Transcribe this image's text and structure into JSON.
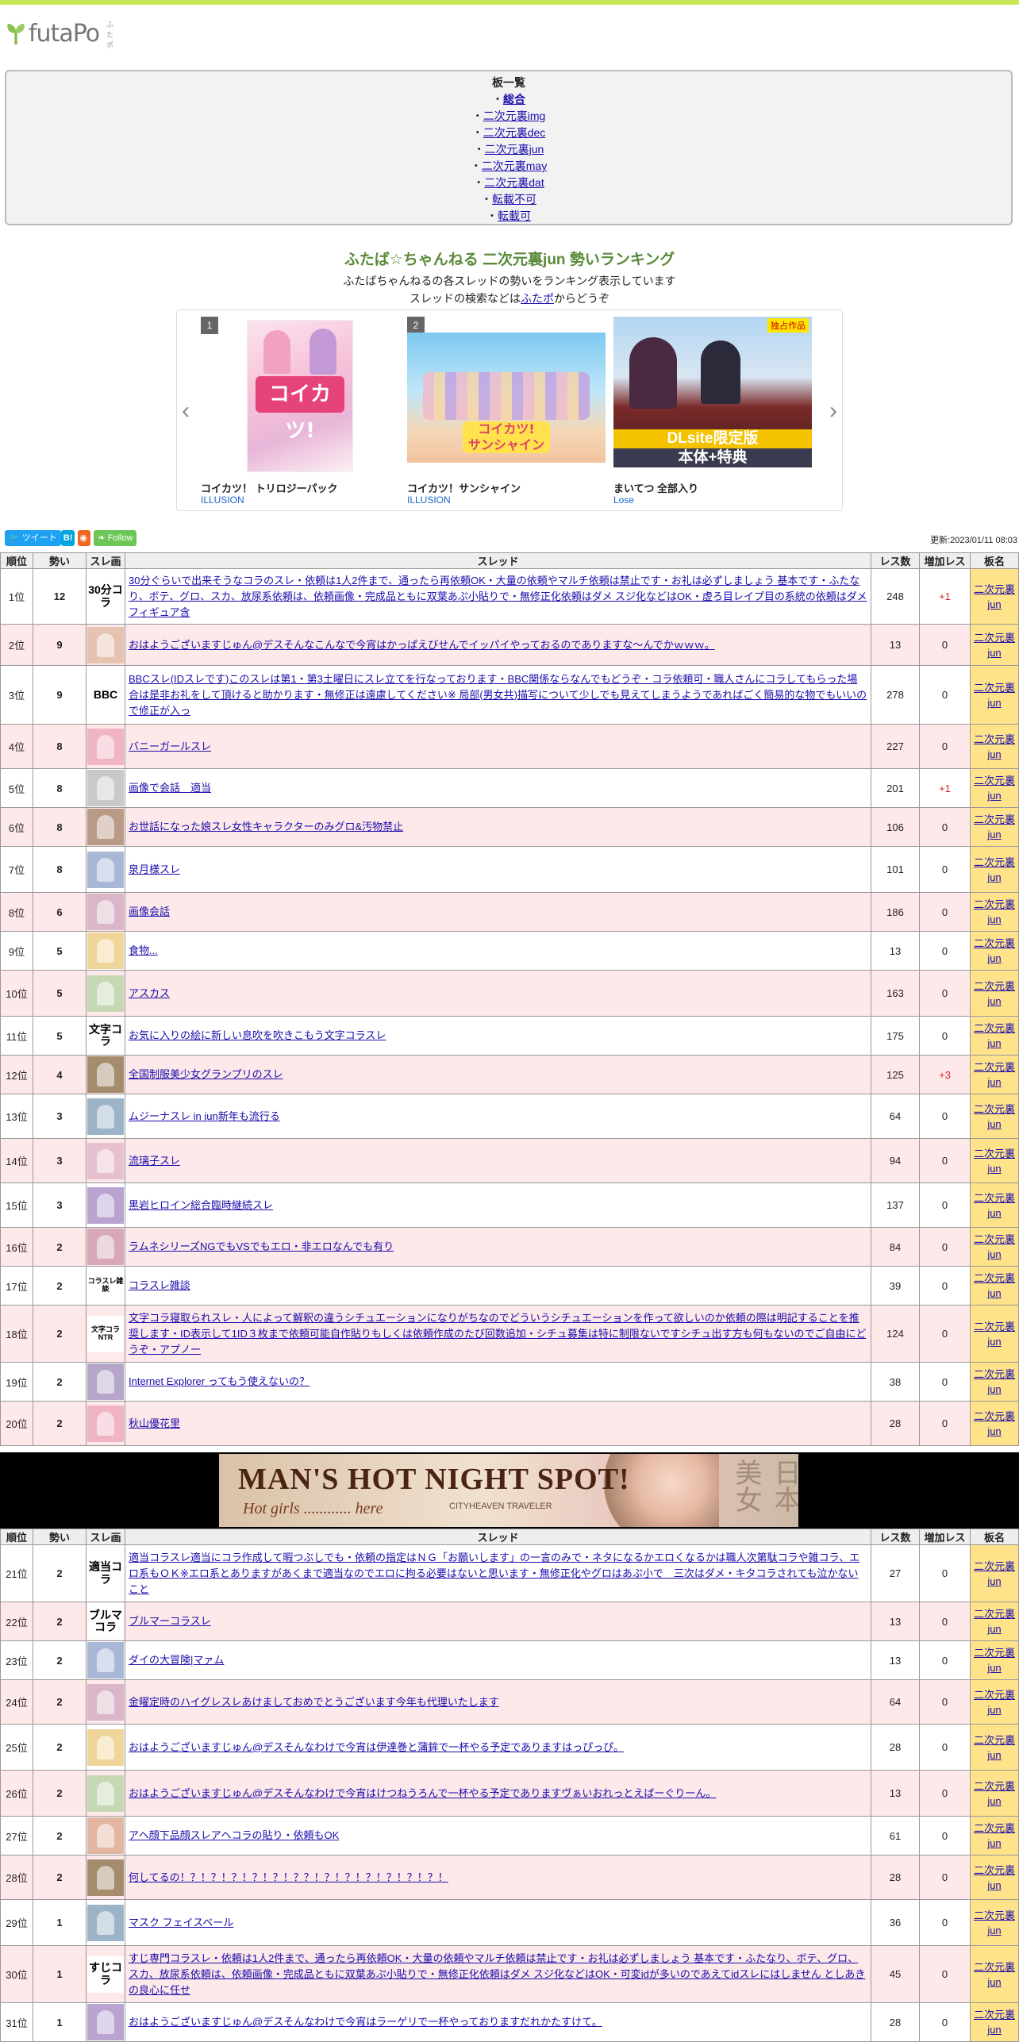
{
  "site": {
    "logo_text": "futaPo",
    "logo_sub": "ふたポ"
  },
  "board_list": {
    "title": "板一覧",
    "items": [
      "総合",
      "二次元裏img",
      "二次元裏dec",
      "二次元裏jun",
      "二次元裏may",
      "二次元裏dat",
      "転載不可",
      "転載可"
    ]
  },
  "ranking": {
    "title": "ふたば☆ちゃんねる 二次元裏jun 勢いランキング",
    "desc1": "ふたばちゃんねるの各スレッドの勢いをランキング表示しています",
    "desc2_pre": "スレッドの検索などは",
    "desc2_link": "ふたポ",
    "desc2_post": "からどうぞ"
  },
  "carousel": [
    {
      "num": "1",
      "name": "コイカツ！ トリロジーパック",
      "maker": "ILLUSION",
      "badge": ""
    },
    {
      "num": "2",
      "name": "コイカツ！サンシャイン",
      "maker": "ILLUSION",
      "badge": ""
    },
    {
      "num": "3",
      "name": "まいてつ 全部入り",
      "maker": "Lose",
      "badge": "独占作品",
      "img_text1": "DLsite限定版",
      "img_text2": "本体+特典"
    }
  ],
  "share": {
    "tweet": "ツイート",
    "hatena": "B!",
    "follow": "Follow"
  },
  "updated": "更新:2023/01/11 08:03",
  "table_headers": [
    "順位",
    "勢い",
    "スレ画",
    "スレッド",
    "レス数",
    "増加レス",
    "板名"
  ],
  "board_name": "二次元裏jun",
  "banner": {
    "headline": "MAN'S HOT NIGHT SPOT!",
    "sub": "Hot girls ............ here",
    "city": "CITYHEAVEN TRAVELER",
    "jp": "日本美女"
  },
  "rows": [
    {
      "rank": "1位",
      "ikioi": "12",
      "thumb": "30分コラ",
      "title": "30分ぐらいで出来そうなコラのスレ・依頼は1人2件まで、通ったら再依頼OK・大量の依頼やマルチ依頼は禁止です・お礼は必ずしましょう 基本です・ふたなり、ボテ、グロ、スカ、放尿系依頼は、依頼画像・完成品ともに双葉あぷ小貼りで・無修正化依頼はダメ スジ化などはOK・虚ろ目レイプ目の系統の依頼はダメ フィギュア含",
      "res": "248",
      "inc": "+1"
    },
    {
      "rank": "2位",
      "ikioi": "9",
      "thumb": "",
      "title": "おはようございますじゅん@デスそんなこんなで今宵はかっぱえびせんでイッパイやっておるのでありますな～んでかｗｗｗ。",
      "res": "13",
      "inc": "0"
    },
    {
      "rank": "3位",
      "ikioi": "9",
      "thumb": "BBC",
      "title": "BBCスレ(IDスレです)このスレは第1・第3土曜日にスレ立てを行なっております・BBC関係ならなんでもどうぞ・コラ依頼可・職人さんにコラしてもらった場合は是非お礼をして頂けると助かります・無修正は遠慮してください※ 局部(男女共)描写について少しでも見えてしまうようであればごく簡易的な物でもいいので修正が入っ",
      "res": "278",
      "inc": "0"
    },
    {
      "rank": "4位",
      "ikioi": "8",
      "thumb": "",
      "title": "バニーガールスレ",
      "res": "227",
      "inc": "0"
    },
    {
      "rank": "5位",
      "ikioi": "8",
      "thumb": "",
      "title": "画像で会話　適当",
      "res": "201",
      "inc": "+1"
    },
    {
      "rank": "6位",
      "ikioi": "8",
      "thumb": "",
      "title": "お世話になった娘スレ女性キャラクターのみグロ&汚物禁止",
      "res": "106",
      "inc": "0"
    },
    {
      "rank": "7位",
      "ikioi": "8",
      "thumb": "",
      "title": "泉月様スレ",
      "res": "101",
      "inc": "0"
    },
    {
      "rank": "8位",
      "ikioi": "6",
      "thumb": "",
      "title": "画像会話",
      "res": "186",
      "inc": "0"
    },
    {
      "rank": "9位",
      "ikioi": "5",
      "thumb": "",
      "title": "食物...",
      "res": "13",
      "inc": "0"
    },
    {
      "rank": "10位",
      "ikioi": "5",
      "thumb": "",
      "title": "アスカス",
      "res": "163",
      "inc": "0"
    },
    {
      "rank": "11位",
      "ikioi": "5",
      "thumb": "文字コラ",
      "title": "お気に入りの絵に新しい息吹を吹きこもう文字コラスレ",
      "res": "175",
      "inc": "0"
    },
    {
      "rank": "12位",
      "ikioi": "4",
      "thumb": "",
      "title": "全国制服美少女グランプリのスレ",
      "res": "125",
      "inc": "+3"
    },
    {
      "rank": "13位",
      "ikioi": "3",
      "thumb": "",
      "title": "ムジーナスレ in jun新年も流行る",
      "res": "64",
      "inc": "0"
    },
    {
      "rank": "14位",
      "ikioi": "3",
      "thumb": "",
      "title": "流璃子スレ",
      "res": "94",
      "inc": "0"
    },
    {
      "rank": "15位",
      "ikioi": "3",
      "thumb": "",
      "title": "黒岩ヒロイン総合臨時継続スレ",
      "res": "137",
      "inc": "0"
    },
    {
      "rank": "16位",
      "ikioi": "2",
      "thumb": "",
      "title": "ラムネシリーズNGでもVSでもエロ・非エロなんでも有り",
      "res": "84",
      "inc": "0"
    },
    {
      "rank": "17位",
      "ikioi": "2",
      "thumb": "コラスレ雑談",
      "title": "コラスレ雑談",
      "res": "39",
      "inc": "0"
    },
    {
      "rank": "18位",
      "ikioi": "2",
      "thumb": "文字コラ NTR",
      "title": "文字コラ寝取られスレ・人によって解釈の違うシチュエーションになりがちなのでどういうシチュエーションを作って欲しいのか依頼の際は明記することを推奨します・ID表示して1ID３枚まで依頼可能自作貼りもしくは依頼作成のたび回数追加・シチュ募集は特に制限ないですシチュ出す方も何もないのでご自由にどうぞ・アプノー",
      "res": "124",
      "inc": "0"
    },
    {
      "rank": "19位",
      "ikioi": "2",
      "thumb": "",
      "title": "Internet Explorer ってもう使えないの？",
      "res": "38",
      "inc": "0"
    },
    {
      "rank": "20位",
      "ikioi": "2",
      "thumb": "",
      "title": "秋山優花里",
      "res": "28",
      "inc": "0"
    },
    {
      "rank": "21位",
      "ikioi": "2",
      "thumb": "適当コラ",
      "title": "適当コラスレ適当にコラ作成して暇つぶしでも・依頼の指定はＮＧ「お願いします」の一言のみで・ネタになるかエロくなるかは職人次第駄コラや雑コラ、エロ系もＯＫ※エロ系とありますがあくまで適当なのでエロに拘る必要はないと思います・無修正化やグロはあぷ小で　三次はダメ・キタコラされても泣かないこと",
      "res": "27",
      "inc": "0"
    },
    {
      "rank": "22位",
      "ikioi": "2",
      "thumb": "ブルマコラ",
      "title": "ブルマーコラスレ",
      "res": "13",
      "inc": "0"
    },
    {
      "rank": "23位",
      "ikioi": "2",
      "thumb": "",
      "title": "ダイの大冒険|マァム",
      "res": "13",
      "inc": "0"
    },
    {
      "rank": "24位",
      "ikioi": "2",
      "thumb": "",
      "title": "金曜定時のハイグレスレあけましておめでとうございます今年も代理いたします",
      "res": "64",
      "inc": "0"
    },
    {
      "rank": "25位",
      "ikioi": "2",
      "thumb": "",
      "title": "おはようございますじゅん@デスそんなわけで今宵は伊達巻と蒲鉾で一杯やる予定でありますはっぴっぴ。",
      "res": "28",
      "inc": "0"
    },
    {
      "rank": "26位",
      "ikioi": "2",
      "thumb": "",
      "title": "おはようございますじゅん@デスそんなわけで今宵はけつねうろんで一杯やる予定でありますヴぁいおれっとえばーぐりーん。",
      "res": "13",
      "inc": "0"
    },
    {
      "rank": "27位",
      "ikioi": "2",
      "thumb": "",
      "title": "アヘ顔下品顔スレアヘコラの貼り・依頼もOK",
      "res": "61",
      "inc": "0"
    },
    {
      "rank": "28位",
      "ikioi": "2",
      "thumb": "",
      "title": "何してるの！？！？！？！？！？！？？！？！？！？！？！？！？！",
      "res": "28",
      "inc": "0"
    },
    {
      "rank": "29位",
      "ikioi": "1",
      "thumb": "",
      "title": "マスク フェイスベール",
      "res": "36",
      "inc": "0"
    },
    {
      "rank": "30位",
      "ikioi": "1",
      "thumb": "すじコラ",
      "title": "すじ専門コラスレ・依頼は1人2件まで、通ったら再依頼OK・大量の依頼やマルチ依頼は禁止です・お礼は必ずしましょう 基本です・ふたなり、ボテ、グロ、スカ、放尿系依頼は、依頼画像・完成品ともに双葉あぷ小貼りで・無修正化依頼はダメ スジ化などはOK・可変idが多いのであえてidスレにはしません としあきの良心に任せ",
      "res": "45",
      "inc": "0"
    },
    {
      "rank": "31位",
      "ikioi": "1",
      "thumb": "",
      "title": "おはようございますじゅん@デスそんなわけで今宵はラーゲリで一杯やっておりますだれかたすけて。",
      "res": "28",
      "inc": "0"
    }
  ]
}
